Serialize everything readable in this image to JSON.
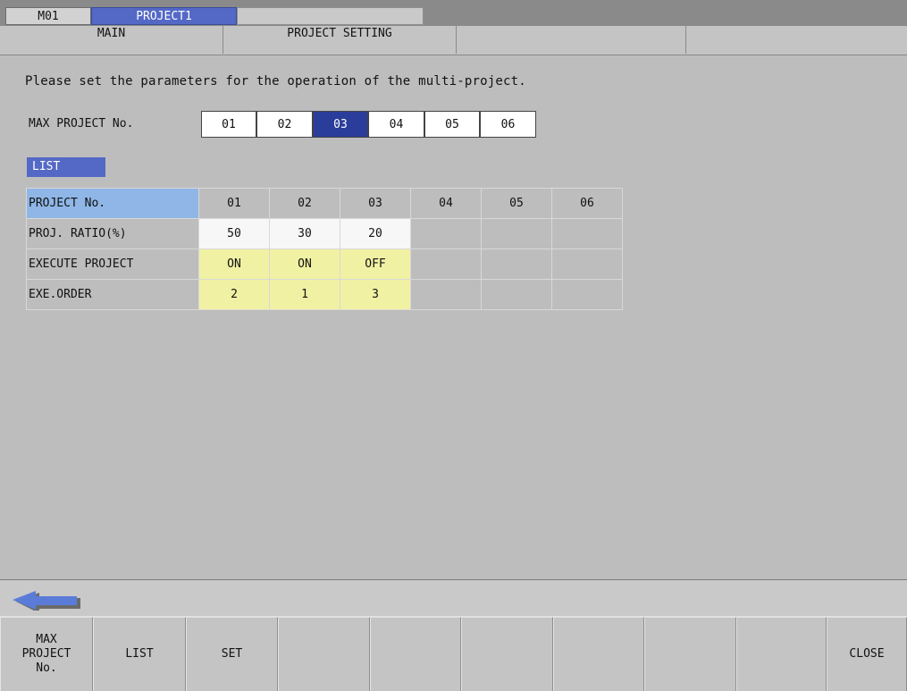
{
  "header": {
    "station": "M01",
    "project_tab": "PROJECT1"
  },
  "tabs": [
    "MAIN",
    "PROJECT SETTING",
    "",
    ""
  ],
  "message": "Please set the parameters for the operation of the multi-project.",
  "max_project": {
    "label": "MAX PROJECT No.",
    "options": [
      "01",
      "02",
      "03",
      "04",
      "05",
      "06"
    ],
    "selected": "03"
  },
  "list_badge": "LIST",
  "table": {
    "header_label": "PROJECT No.",
    "columns": [
      "01",
      "02",
      "03",
      "04",
      "05",
      "06"
    ],
    "rows": [
      {
        "label": "PROJ. RATIO(%)",
        "values": [
          "50",
          "30",
          "20",
          "",
          "",
          ""
        ]
      },
      {
        "label": "EXECUTE PROJECT",
        "values": [
          "ON",
          "ON",
          "OFF",
          "",
          "",
          ""
        ]
      },
      {
        "label": "EXE.ORDER",
        "values": [
          "2",
          "1",
          "3",
          "",
          "",
          ""
        ]
      }
    ]
  },
  "function_keys": [
    "MAX\nPROJECT\nNo.",
    "LIST",
    "SET",
    "",
    "",
    "",
    "",
    "",
    "",
    "CLOSE"
  ],
  "colors": {
    "accent_blue": "#5468c6",
    "selected_dark_blue": "#2b3d9a",
    "header_cell_blue": "#8fb6e6",
    "editable_yellow": "#f1f1a4",
    "background_gray": "#bdbdbd"
  },
  "icons": {
    "back": "back-arrow-icon"
  }
}
